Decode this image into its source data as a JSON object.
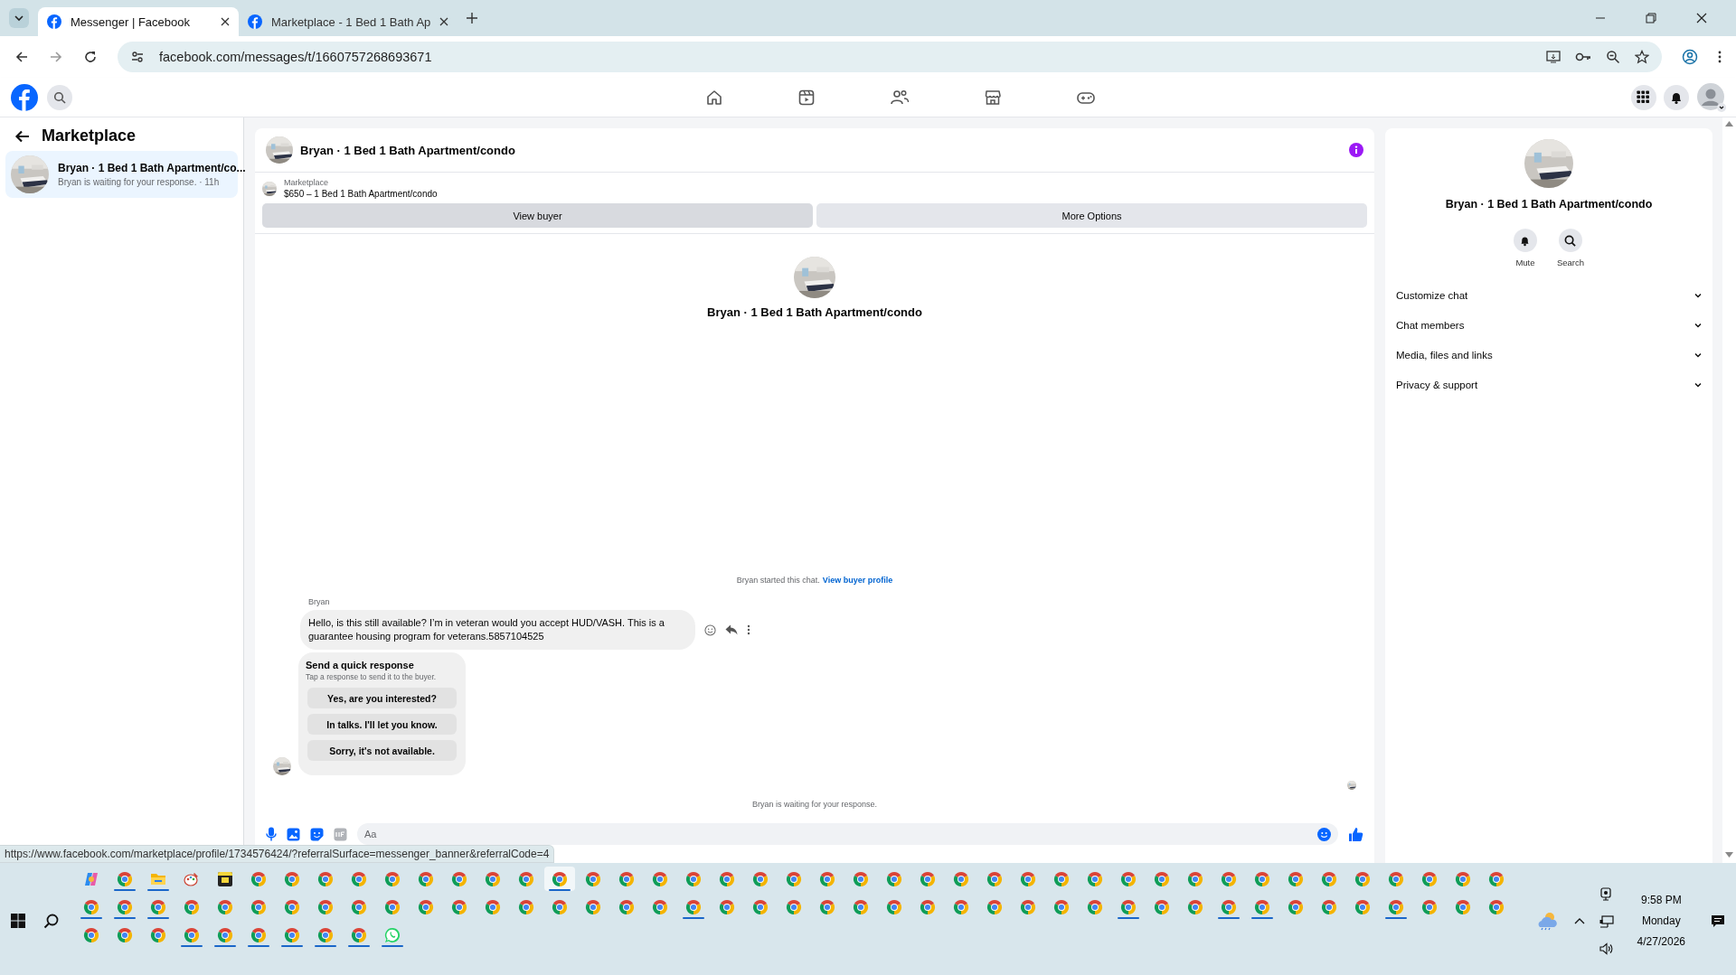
{
  "browser": {
    "tabs": [
      {
        "title": "Messenger | Facebook",
        "selected": true
      },
      {
        "title": "Marketplace - 1 Bed 1 Bath Ap",
        "selected": false
      }
    ],
    "url": "facebook.com/messages/t/1660757268693671"
  },
  "sidebar": {
    "title": "Marketplace",
    "conversations": [
      {
        "title": "Bryan · 1 Bed 1 Bath Apartment/co...",
        "preview": "Bryan is waiting for your response. · 11h",
        "selected": true
      }
    ]
  },
  "chat": {
    "title": "Bryan · 1 Bed 1 Bath Apartment/condo",
    "listing": {
      "label": "Marketplace",
      "detail": "$650 – 1 Bed 1 Bath Apartment/condo"
    },
    "actions": [
      "View buyer",
      "More Options"
    ],
    "profile_name": "Bryan · 1 Bed 1 Bath Apartment/condo",
    "started": {
      "text": "Bryan started this chat.",
      "link": "View buyer profile"
    },
    "sender": "Bryan",
    "message": "Hello, is this still available? I’m in veteran would you accept HUD/VASH. This is a guarantee housing program for veterans.5857104525",
    "quick_response": {
      "title": "Send a quick response",
      "hint": "Tap a response to send it to the buyer.",
      "options": [
        "Yes, are you interested?",
        "In talks. I'll let you know.",
        "Sorry, it's not available."
      ]
    },
    "status": "Bryan is waiting for your response.",
    "composer": {
      "placeholder": "Aa"
    }
  },
  "details": {
    "name": "Bryan · 1 Bed 1 Bath Apartment/condo",
    "actions": [
      {
        "label": "Mute",
        "kind": "bell"
      },
      {
        "label": "Search",
        "kind": "search"
      }
    ],
    "sections": [
      {
        "label": "Customize chat",
        "expanded": false
      },
      {
        "label": "Chat members",
        "expanded": false
      },
      {
        "label": "Media, files and links",
        "expanded": false
      },
      {
        "label": "Privacy & support",
        "expanded": false
      }
    ]
  },
  "status_url": "https://www.facebook.com/marketplace/profile/1734576424/?referralSurface=messenger_banner&referralCode=4",
  "taskbar": {
    "rows": [
      [
        {
          "kind": "copilot",
          "running": false,
          "selected": false
        },
        {
          "kind": "chrome",
          "running": true,
          "selected": false
        },
        {
          "kind": "files",
          "running": true,
          "selected": false
        },
        {
          "kind": "paint",
          "running": false,
          "selected": false
        },
        {
          "kind": "sticky",
          "running": false,
          "selected": false
        },
        {
          "kind": "chrome",
          "running": false,
          "selected": false
        },
        {
          "kind": "chrome",
          "running": false,
          "selected": false
        },
        {
          "kind": "chrome",
          "running": false,
          "selected": false
        },
        {
          "kind": "chrome",
          "running": false,
          "selected": false
        },
        {
          "kind": "chrome",
          "running": false,
          "selected": false
        },
        {
          "kind": "chrome",
          "running": false,
          "selected": false
        },
        {
          "kind": "chrome",
          "running": false,
          "selected": false
        },
        {
          "kind": "chrome",
          "running": false,
          "selected": false
        },
        {
          "kind": "chrome",
          "running": false,
          "selected": false
        },
        {
          "kind": "chrome",
          "running": true,
          "selected": true
        },
        {
          "kind": "chrome",
          "running": false,
          "selected": false
        },
        {
          "kind": "chrome",
          "running": false,
          "selected": false
        },
        {
          "kind": "chrome",
          "running": false,
          "selected": false
        },
        {
          "kind": "chrome",
          "running": false,
          "selected": false
        },
        {
          "kind": "chrome",
          "running": false,
          "selected": false
        },
        {
          "kind": "chrome",
          "running": false,
          "selected": false
        },
        {
          "kind": "chrome",
          "running": false,
          "selected": false
        },
        {
          "kind": "chrome",
          "running": false,
          "selected": false
        },
        {
          "kind": "chrome",
          "running": false,
          "selected": false
        },
        {
          "kind": "chrome",
          "running": false,
          "selected": false
        },
        {
          "kind": "chrome",
          "running": false,
          "selected": false
        },
        {
          "kind": "chrome",
          "running": false,
          "selected": false
        },
        {
          "kind": "chrome",
          "running": false,
          "selected": false
        },
        {
          "kind": "chrome",
          "running": false,
          "selected": false
        },
        {
          "kind": "chrome",
          "running": false,
          "selected": false
        },
        {
          "kind": "chrome",
          "running": false,
          "selected": false
        },
        {
          "kind": "chrome",
          "running": false,
          "selected": false
        },
        {
          "kind": "chrome",
          "running": false,
          "selected": false
        },
        {
          "kind": "chrome",
          "running": false,
          "selected": false
        },
        {
          "kind": "chrome",
          "running": false,
          "selected": false
        },
        {
          "kind": "chrome",
          "running": false,
          "selected": false
        },
        {
          "kind": "chrome",
          "running": false,
          "selected": false
        },
        {
          "kind": "chrome",
          "running": false,
          "selected": false
        },
        {
          "kind": "chrome",
          "running": false,
          "selected": false
        },
        {
          "kind": "chrome",
          "running": false,
          "selected": false
        },
        {
          "kind": "chrome",
          "running": false,
          "selected": false
        },
        {
          "kind": "chrome",
          "running": false,
          "selected": false
        },
        {
          "kind": "chrome",
          "running": false,
          "selected": false
        }
      ],
      [
        {
          "kind": "chrome",
          "running": true,
          "selected": false
        },
        {
          "kind": "chrome",
          "running": true,
          "selected": false
        },
        {
          "kind": "chrome",
          "running": true,
          "selected": false
        },
        {
          "kind": "chrome",
          "running": false,
          "selected": false
        },
        {
          "kind": "chrome",
          "running": false,
          "selected": false
        },
        {
          "kind": "chrome",
          "running": false,
          "selected": false
        },
        {
          "kind": "chrome",
          "running": false,
          "selected": false
        },
        {
          "kind": "chrome",
          "running": false,
          "selected": false
        },
        {
          "kind": "chrome",
          "running": false,
          "selected": false
        },
        {
          "kind": "chrome",
          "running": false,
          "selected": false
        },
        {
          "kind": "chrome",
          "running": false,
          "selected": false
        },
        {
          "kind": "chrome",
          "running": false,
          "selected": false
        },
        {
          "kind": "chrome",
          "running": false,
          "selected": false
        },
        {
          "kind": "chrome",
          "running": false,
          "selected": false
        },
        {
          "kind": "chrome",
          "running": false,
          "selected": false
        },
        {
          "kind": "chrome",
          "running": false,
          "selected": false
        },
        {
          "kind": "chrome",
          "running": false,
          "selected": false
        },
        {
          "kind": "chrome",
          "running": false,
          "selected": false
        },
        {
          "kind": "chrome",
          "running": true,
          "selected": false
        },
        {
          "kind": "chrome",
          "running": false,
          "selected": false
        },
        {
          "kind": "chrome",
          "running": false,
          "selected": false
        },
        {
          "kind": "chrome",
          "running": false,
          "selected": false
        },
        {
          "kind": "chrome",
          "running": false,
          "selected": false
        },
        {
          "kind": "chrome",
          "running": false,
          "selected": false
        },
        {
          "kind": "chrome",
          "running": false,
          "selected": false
        },
        {
          "kind": "chrome",
          "running": false,
          "selected": false
        },
        {
          "kind": "chrome",
          "running": false,
          "selected": false
        },
        {
          "kind": "chrome",
          "running": false,
          "selected": false
        },
        {
          "kind": "chrome",
          "running": false,
          "selected": false
        },
        {
          "kind": "chrome",
          "running": false,
          "selected": false
        },
        {
          "kind": "chrome",
          "running": false,
          "selected": false
        },
        {
          "kind": "chrome",
          "running": true,
          "selected": false
        },
        {
          "kind": "chrome",
          "running": false,
          "selected": false
        },
        {
          "kind": "chrome",
          "running": false,
          "selected": false
        },
        {
          "kind": "chrome",
          "running": true,
          "selected": false
        },
        {
          "kind": "chrome",
          "running": true,
          "selected": false
        },
        {
          "kind": "chrome",
          "running": false,
          "selected": false
        },
        {
          "kind": "chrome",
          "running": false,
          "selected": false
        },
        {
          "kind": "chrome",
          "running": false,
          "selected": false
        },
        {
          "kind": "chrome",
          "running": true,
          "selected": false
        },
        {
          "kind": "chrome",
          "running": false,
          "selected": false
        },
        {
          "kind": "chrome",
          "running": false,
          "selected": false
        },
        {
          "kind": "chrome",
          "running": false,
          "selected": false
        }
      ],
      [
        {
          "kind": "chrome",
          "running": false,
          "selected": false
        },
        {
          "kind": "chrome",
          "running": false,
          "selected": false
        },
        {
          "kind": "chrome",
          "running": false,
          "selected": false
        },
        {
          "kind": "chrome",
          "running": true,
          "selected": false
        },
        {
          "kind": "chrome",
          "running": true,
          "selected": false
        },
        {
          "kind": "chrome",
          "running": true,
          "selected": false
        },
        {
          "kind": "chrome",
          "running": true,
          "selected": false
        },
        {
          "kind": "chrome",
          "running": true,
          "selected": false
        },
        {
          "kind": "chrome",
          "running": true,
          "selected": false
        },
        {
          "kind": "whatsapp",
          "running": true,
          "selected": false
        }
      ]
    ],
    "clock": {
      "time": "9:58 PM",
      "day": "Monday",
      "date": "4/27/2026"
    }
  }
}
